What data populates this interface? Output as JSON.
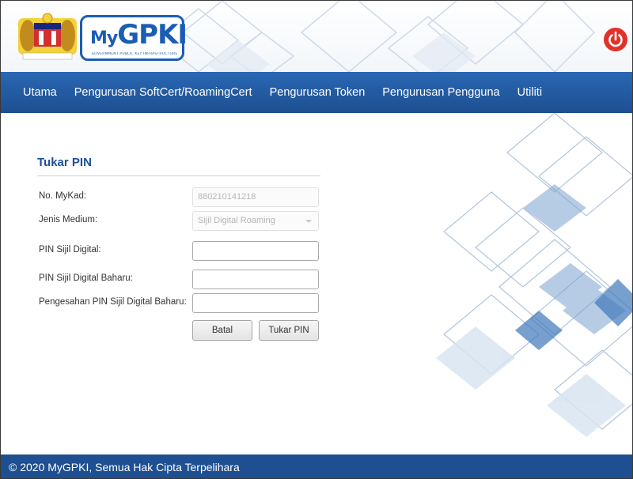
{
  "header": {
    "logo_text_my": "My",
    "logo_text_g": "G",
    "logo_text_rest": "PKI",
    "logo_subtitle": "GOVERNMENT PUBLIC KEY INFRASTRUCTURE",
    "accent_color": "#1b5db5",
    "power_icon": "power-icon",
    "power_color": "#e0322b"
  },
  "nav": {
    "items": [
      {
        "label": "Utama"
      },
      {
        "label": "Pengurusan SoftCert/RoamingCert"
      },
      {
        "label": "Pengurusan Token"
      },
      {
        "label": "Pengurusan Pengguna"
      },
      {
        "label": "Utiliti"
      }
    ],
    "bg_color": "#1d4f91"
  },
  "form": {
    "title": "Tukar PIN",
    "mykad_label": "No. MyKad:",
    "mykad_value": "880210141218",
    "medium_label": "Jenis Medium:",
    "medium_value": "Sijil Digital Roaming",
    "pin_label": "PIN Sijil Digital:",
    "pin_value": "",
    "new_pin_label": "PIN Sijil Digital Baharu:",
    "new_pin_value": "",
    "confirm_pin_label": "Pengesahan PIN Sijil Digital Baharu:",
    "confirm_pin_value": "",
    "cancel_label": "Batal",
    "submit_label": "Tukar PIN"
  },
  "footer": {
    "copyright": "© 2020 MyGPKI, Semua Hak Cipta Terpelihara"
  }
}
